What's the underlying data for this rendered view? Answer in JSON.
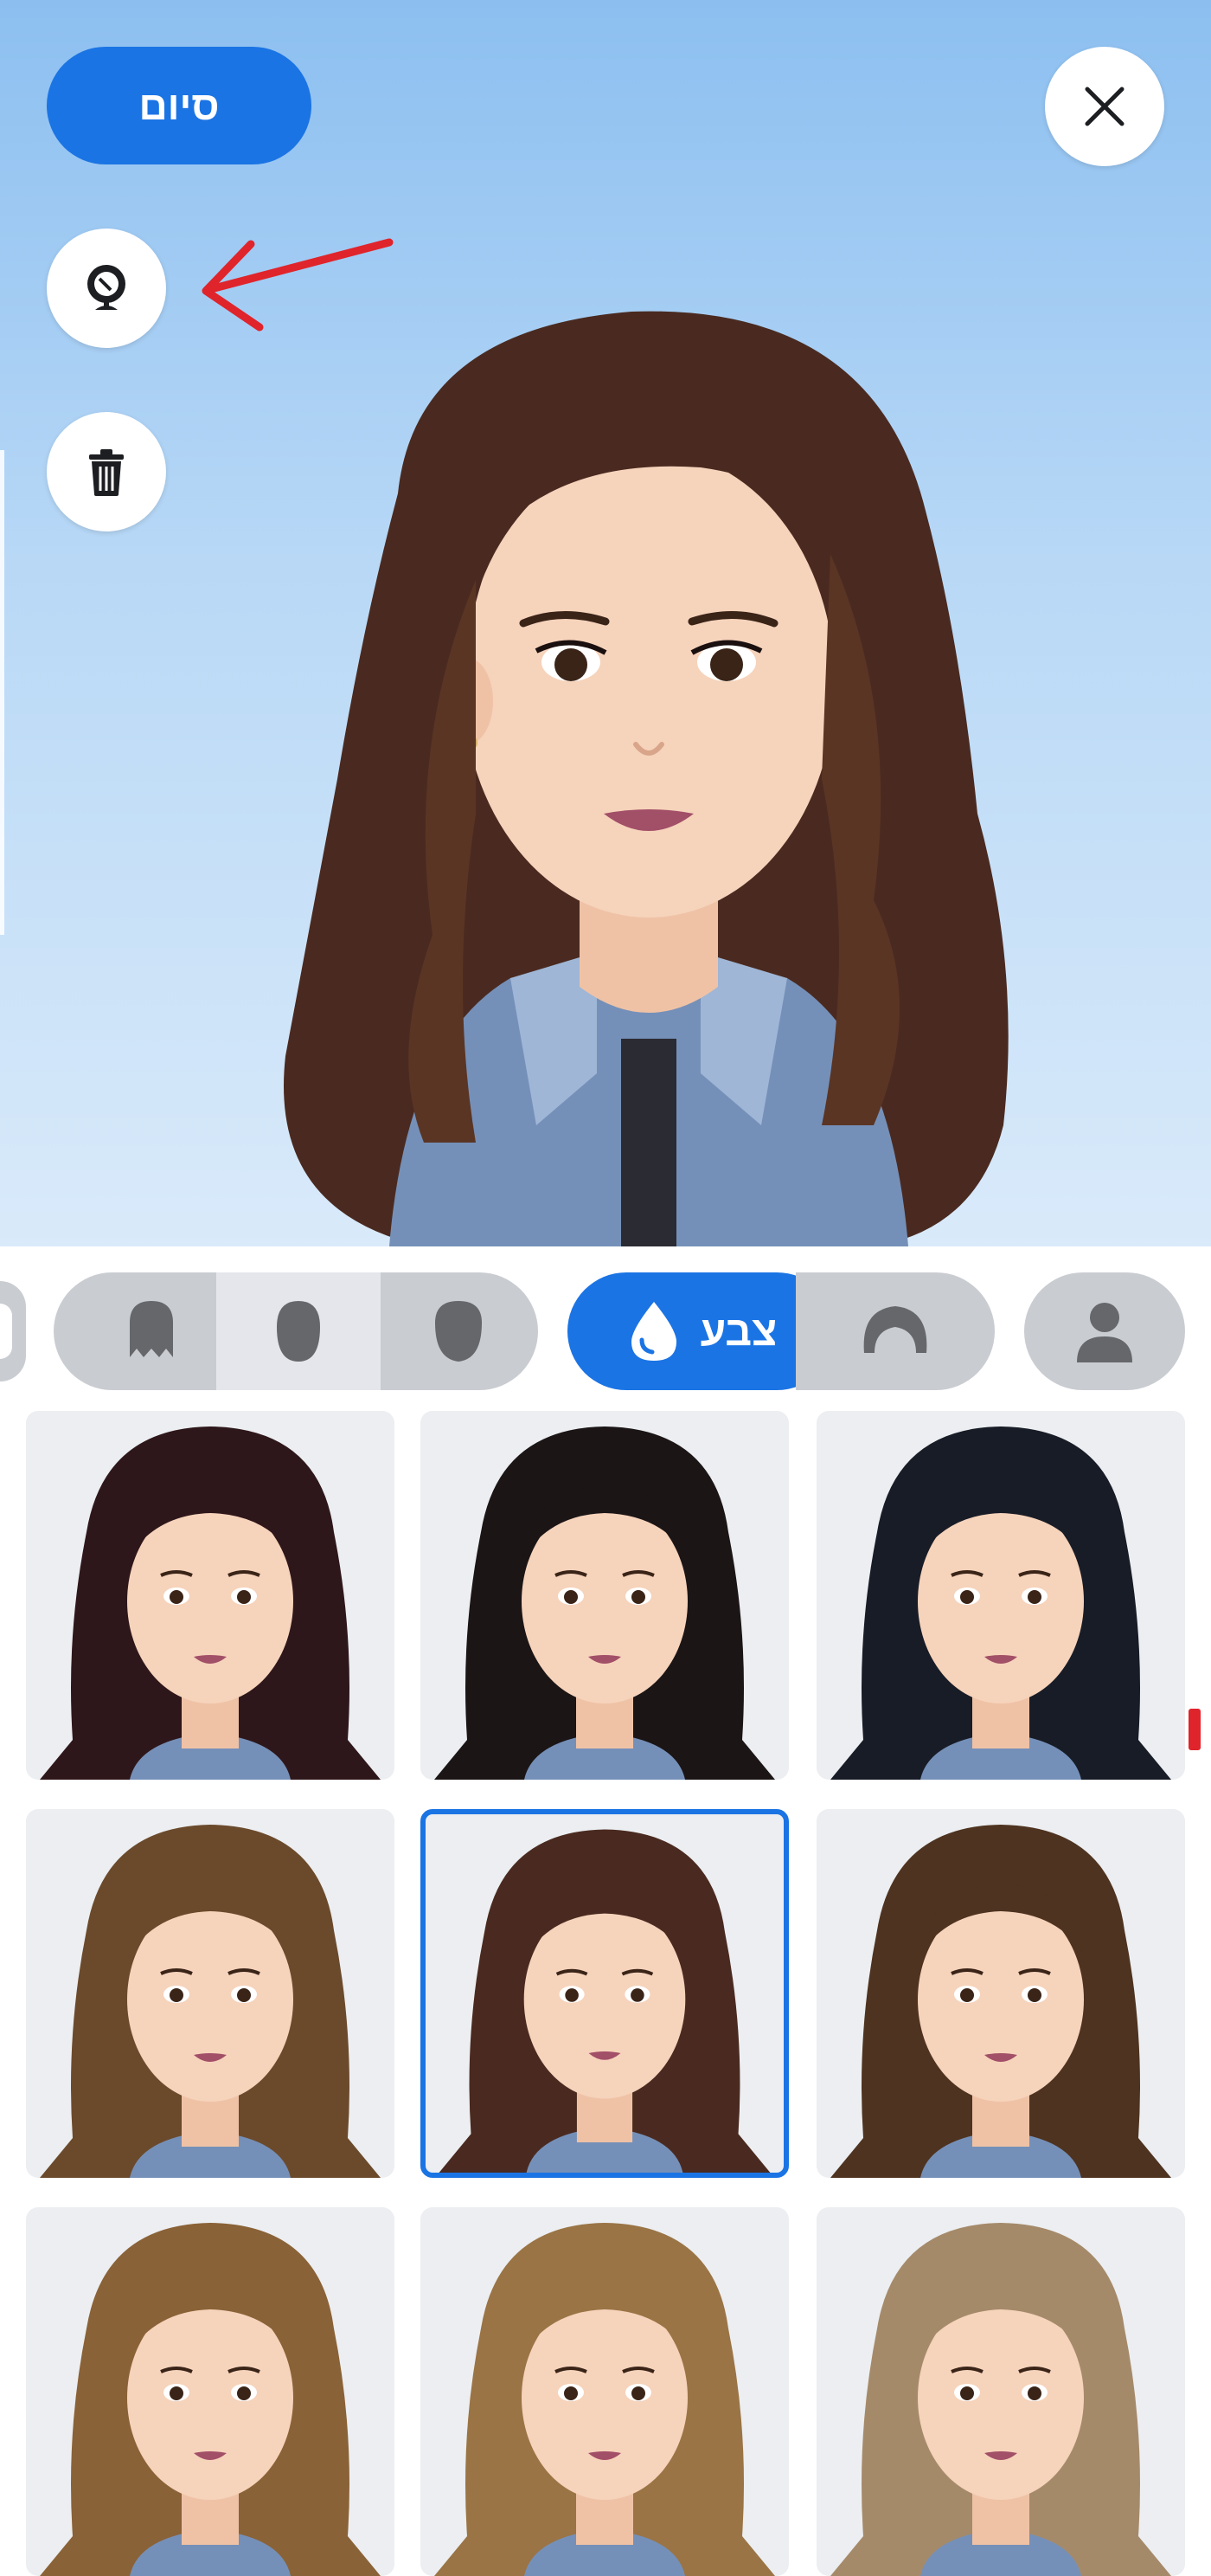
{
  "header": {
    "done_label": "סיום",
    "close_icon": "close-icon",
    "mirror_icon": "mirror-icon",
    "trash_icon": "trash-icon"
  },
  "tabs": [
    {
      "id": "body",
      "icon": "person-icon",
      "selected": false
    },
    {
      "id": "hair",
      "icon": "hair-icon",
      "selected": false
    },
    {
      "id": "color",
      "icon": "droplet-icon",
      "label": "צבע",
      "selected": true
    },
    {
      "id": "face-shape-1",
      "icon": "face-icon",
      "selected": false
    },
    {
      "id": "face-shape-2",
      "icon": "face-icon",
      "selected": false
    },
    {
      "id": "face-shape-3",
      "icon": "face-icon",
      "selected": false
    }
  ],
  "colors": {
    "accent": "#1b74e4",
    "annotation": "#e0242b",
    "skin": "#f6d3bb"
  },
  "hair_options": [
    {
      "hair": "#2e171a",
      "selected": false
    },
    {
      "hair": "#1b1516",
      "selected": false
    },
    {
      "hair": "#181c26",
      "selected": false
    },
    {
      "hair": "#6b4a2c",
      "selected": false
    },
    {
      "hair": "#4a2a20",
      "selected": true
    },
    {
      "hair": "#4e3320",
      "selected": false
    },
    {
      "hair": "#8a6237",
      "selected": false
    },
    {
      "hair": "#9a7445",
      "selected": false
    },
    {
      "hair": "#a58a6a",
      "selected": false
    }
  ]
}
